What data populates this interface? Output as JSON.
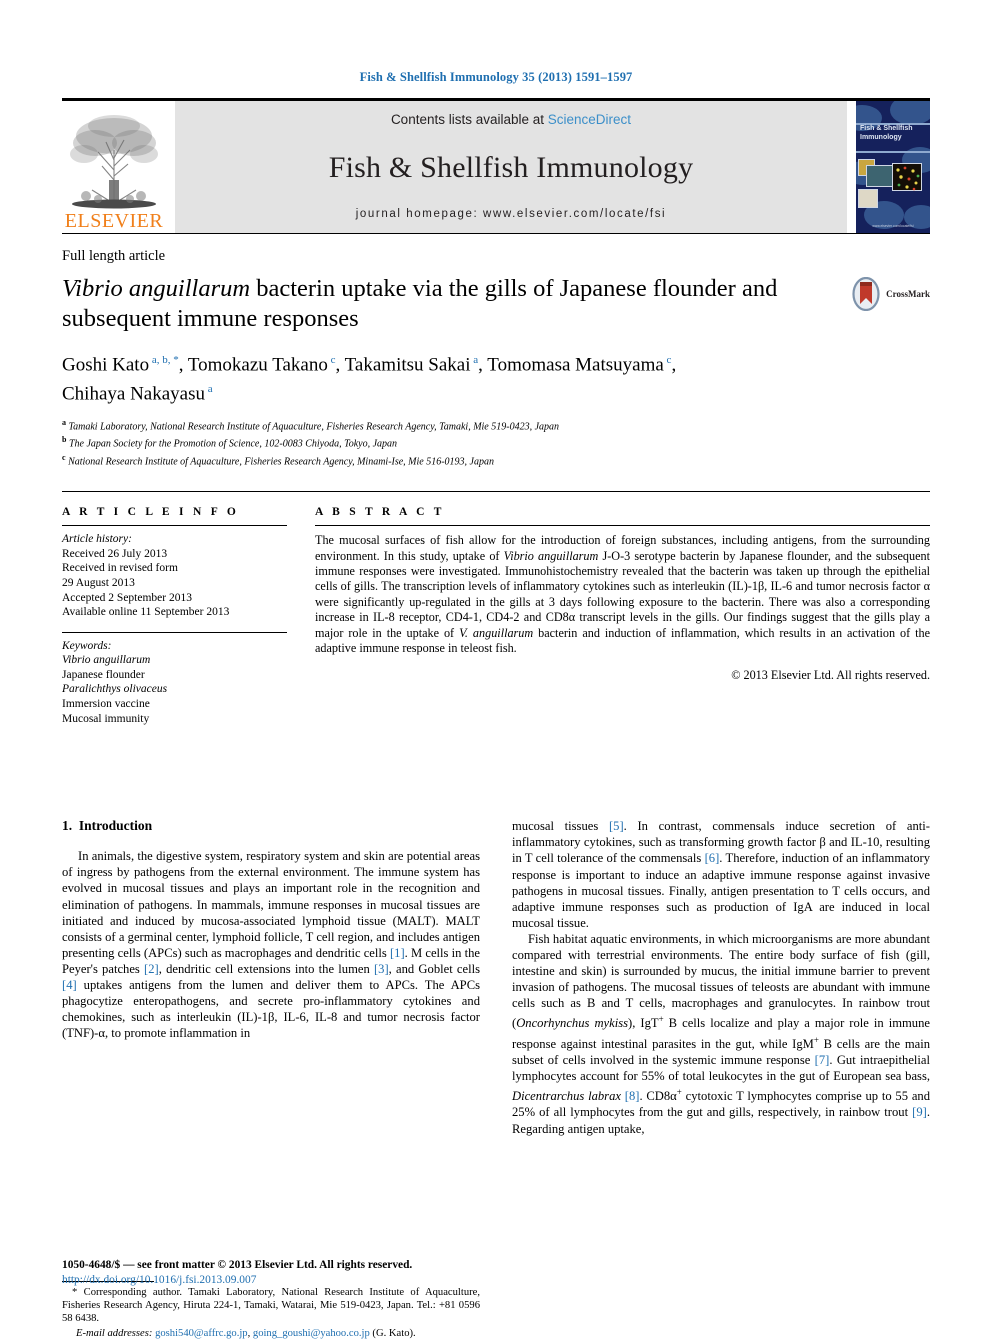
{
  "running_head": "Fish & Shellfish Immunology 35 (2013) 1591–1597",
  "masthead": {
    "publisher_name": "ELSEVIER",
    "contents_prefix": "Contents lists available at ",
    "contents_link": "ScienceDirect",
    "journal_title": "Fish & Shellfish Immunology",
    "homepage": "journal homepage: www.elsevier.com/locate/fsi",
    "cover_journal_name": "Fish & Shellfish\nImmunology",
    "cover_footer_text": "www.elsevier.com/locate/fsi"
  },
  "article": {
    "type": "Full length article",
    "title_part1": "Vibrio anguillarum",
    "title_part2": " bacterin uptake via the gills of Japanese flounder and subsequent immune responses",
    "crossmark_label": "CrossMark",
    "authors_line1_a": "Goshi Kato",
    "authors_sup_a": "a, b,",
    "authors_star": "*",
    "authors_rest": ", Tomokazu Takano",
    "authors_full": "Goshi Kato a, b, *, Tomokazu Takano c, Takamitsu Sakai a, Tomomasa Matsuyama c, Chihaya Nakayasu a",
    "affiliations": [
      {
        "marker": "a",
        "text": "Tamaki Laboratory, National Research Institute of Aquaculture, Fisheries Research Agency, Tamaki, Mie 519-0423, Japan"
      },
      {
        "marker": "b",
        "text": "The Japan Society for the Promotion of Science, 102-0083 Chiyoda, Tokyo, Japan"
      },
      {
        "marker": "c",
        "text": "National Research Institute of Aquaculture, Fisheries Research Agency, Minami-Ise, Mie 516-0193, Japan"
      }
    ]
  },
  "article_info": {
    "heading": "A R T I C L E    I N F O",
    "history_label": "Article history:",
    "history": [
      "Received 26 July 2013",
      "Received in revised form",
      "29 August 2013",
      "Accepted 2 September 2013",
      "Available online 11 September 2013"
    ],
    "keywords_label": "Keywords:",
    "keywords": [
      "Vibrio anguillarum",
      "Japanese flounder",
      "Paralichthys olivaceus",
      "Immersion vaccine",
      "Mucosal immunity"
    ]
  },
  "abstract": {
    "heading": "A B S T R A C T",
    "text": "The mucosal surfaces of fish allow for the introduction of foreign substances, including antigens, from the surrounding environment. In this study, uptake of Vibrio anguillarum J-O-3 serotype bacterin by Japanese flounder, and the subsequent immune responses were investigated. Immunohistochemistry revealed that the bacterin was taken up through the epithelial cells of gills. The transcription levels of inflammatory cytokines such as interleukin (IL)-1β, IL-6 and tumor necrosis factor α were significantly up-regulated in the gills at 3 days following exposure to the bacterin. There was also a corresponding increase in IL-8 receptor, CD4-1, CD4-2 and CD8α transcript levels in the gills. Our findings suggest that the gills play a major role in the uptake of V. anguillarum bacterin and induction of inflammation, which results in an activation of the adaptive immune response in teleost fish.",
    "copyright": "© 2013 Elsevier Ltd. All rights reserved."
  },
  "introduction": {
    "section_number": "1.",
    "section_title": "Introduction",
    "left_paragraph": "In animals, the digestive system, respiratory system and skin are potential areas of ingress by pathogens from the external environment. The immune system has evolved in mucosal tissues and plays an important role in the recognition and elimination of pathogens. In mammals, immune responses in mucosal tissues are initiated and induced by mucosa-associated lymphoid tissue (MALT). MALT consists of a germinal center, lymphoid follicle, T cell region, and includes antigen presenting cells (APCs) such as macrophages and dendritic cells [1]. M cells in the Peyer's patches [2], dendritic cell extensions into the lumen [3], and Goblet cells [4] uptakes antigens from the lumen and deliver them to APCs. The APCs phagocytize enteropathogens, and secrete pro-inflammatory cytokines and chemokines, such as interleukin (IL)-1β, IL-6, IL-8 and tumor necrosis factor (TNF)-α, to promote inflammation in",
    "right_paragraph_1": "mucosal tissues [5]. In contrast, commensals induce secretion of anti-inflammatory cytokines, such as transforming growth factor β and IL-10, resulting in T cell tolerance of the commensals [6]. Therefore, induction of an inflammatory response is important to induce an adaptive immune response against invasive pathogens in mucosal tissues. Finally, antigen presentation to T cells occurs, and adaptive immune responses such as production of IgA are induced in local mucosal tissue.",
    "right_paragraph_2": "Fish habitat aquatic environments, in which microorganisms are more abundant compared with terrestrial environments. The entire body surface of fish (gill, intestine and skin) is surrounded by mucus, the initial immune barrier to prevent invasion of pathogens. The mucosal tissues of teleosts are abundant with immune cells such as B and T cells, macrophages and granulocytes. In rainbow trout (Oncorhynchus mykiss), IgT+ B cells localize and play a major role in immune response against intestinal parasites in the gut, while IgM+ B cells are the main subset of cells involved in the systemic immune response [7]. Gut intraepithelial lymphocytes account for 55% of total leukocytes in the gut of European sea bass, Dicentrarchus labrax [8]. CD8α+ cytotoxic T lymphocytes comprise up to 55 and 25% of all lymphocytes from the gut and gills, respectively, in rainbow trout [9]. Regarding antigen uptake,"
  },
  "footnote": {
    "star": "*",
    "text": "Corresponding author. Tamaki Laboratory, National Research Institute of Aquaculture, Fisheries Research Agency, Hiruta 224-1, Tamaki, Watarai, Mie 519-0423, Japan. Tel.: +81 0596 58 6438.",
    "email_label": "E-mail addresses:",
    "email_1": "goshi540@affrc.go.jp",
    "email_2": "going_goushi@yahoo.co.jp",
    "email_suffix": "(G. Kato)."
  },
  "footer": {
    "issn_line": "1050-4648/$ — see front matter © 2013 Elsevier Ltd. All rights reserved.",
    "doi": "http://dx.doi.org/10.1016/j.fsi.2013.09.007"
  },
  "colors": {
    "link_blue": "#1f6fb0",
    "sciencedirect_blue": "#3c8fc9",
    "elsevier_orange": "#f07f1a",
    "band_gray": "#e3e3e3",
    "cover_navy": "#15215c"
  }
}
